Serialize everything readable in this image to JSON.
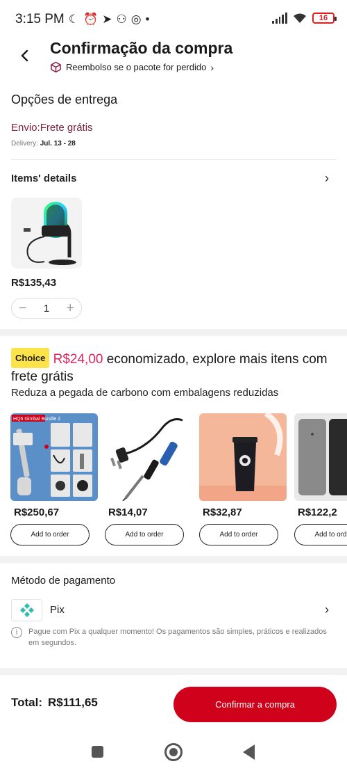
{
  "status_bar": {
    "time": "3:15 PM",
    "icons": [
      "moon-icon",
      "alarm-icon",
      "telegram-icon",
      "network-icon",
      "sensor-icon",
      "dot-icon"
    ],
    "battery": "16"
  },
  "header": {
    "title": "Confirmação da compra",
    "refund_text": "Reembolso se o pacote for perdido"
  },
  "delivery": {
    "section_title": "Opções de entrega",
    "method": "Envio:Frete grátis",
    "date_label": "Delivery:",
    "date_value": "Jul. 13 - 28"
  },
  "items": {
    "title": "Items' details",
    "price": "R$135,43",
    "quantity": "1"
  },
  "choice": {
    "badge": "Choice",
    "saved_amount": "R$24,00",
    "headline_rest": " economizado, explore mais itens com frete grátis",
    "subtitle": "Reduza a pegada de carbono com embalagens reduzidas",
    "image_tag": "HQ6 Gimbal Bundle 2",
    "products": [
      {
        "price": "R$250,67",
        "button": "Add to order"
      },
      {
        "price": "R$14,07",
        "button": "Add to order"
      },
      {
        "price": "R$32,87",
        "button": "Add to order"
      },
      {
        "price": "R$122,2",
        "button": "Add to order"
      }
    ]
  },
  "payment": {
    "title": "Método de pagamento",
    "method": "Pix",
    "note": "Pague com Pix a qualquer momento! Os pagamentos são simples, práticos e realizados em segundos."
  },
  "footer": {
    "total_label": "Total:",
    "total_value": "R$111,65",
    "confirm_label": "Confirmar a compra"
  },
  "colors": {
    "accent": "#d0021b",
    "saved": "#e0245e",
    "choice_badge": "#fce34a",
    "delivery_method": "#7a1f3d",
    "pix": "#32bcad"
  }
}
